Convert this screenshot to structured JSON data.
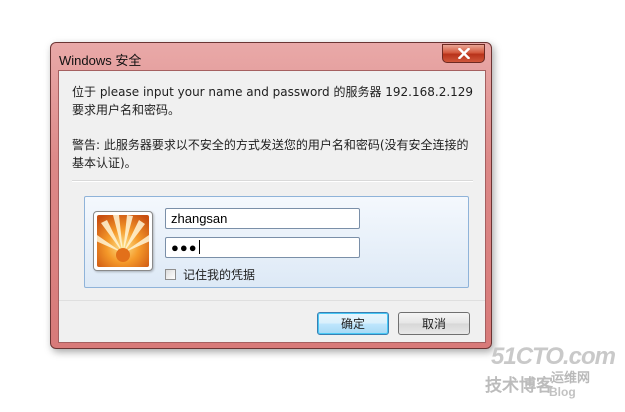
{
  "dialog": {
    "title": "Windows 安全",
    "message_line1": "位于 please input your name and password 的服务器 192.168.2.129 要求用户名和密码。",
    "message_line2": "警告: 此服务器要求以不安全的方式发送您的用户名和密码(没有安全连接的基本认证)。",
    "username_value": "zhangsan",
    "password_mask": "●●●",
    "remember_label": "记住我的凭据",
    "remember_checked": false,
    "ok_label": "确定",
    "cancel_label": "取消",
    "icons": {
      "close": "close-icon",
      "avatar": "user-avatar-flower"
    }
  },
  "watermark": {
    "logo": "51CTO.com",
    "subtitle": "技术博客",
    "tag": "运维网",
    "blog": "Blog"
  },
  "colors": {
    "frame": "#d97f7e",
    "close": "#c7432a",
    "credential_panel": "#dde9f6",
    "ok_button": "#bee6fd"
  }
}
